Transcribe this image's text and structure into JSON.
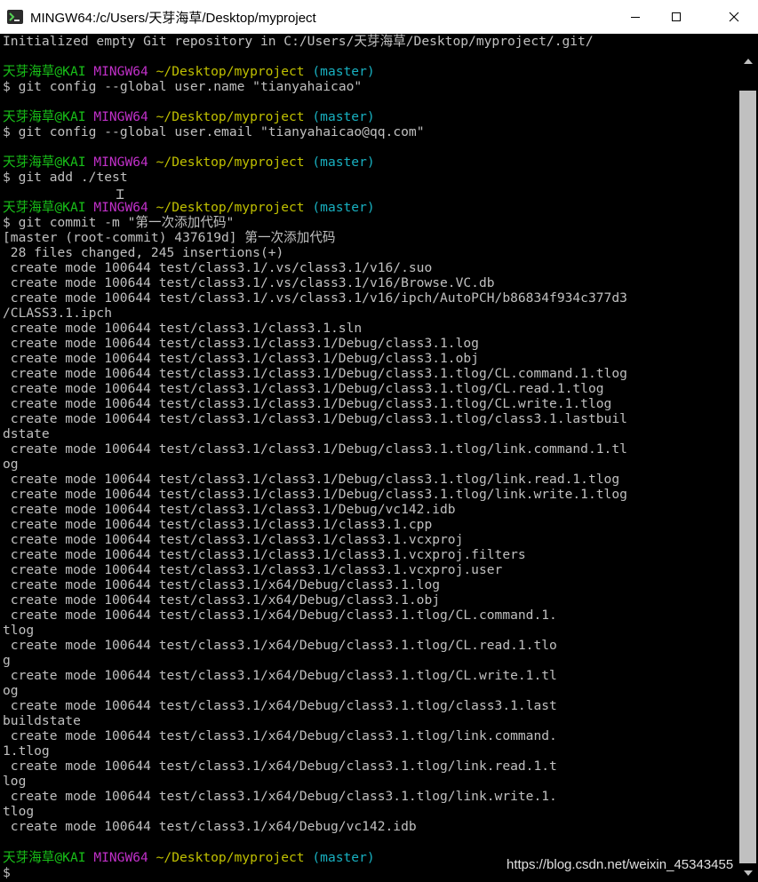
{
  "window": {
    "title": "MINGW64:/c/Users/天芽海草/Desktop/myproject",
    "icon": "mingw-terminal-icon",
    "controls": [
      "minimize-icon",
      "maximize-icon",
      "close-icon"
    ]
  },
  "colors": {
    "background": "#000000",
    "text": "#c0c0c0",
    "user_host": "#18c018",
    "system": "#c030c8",
    "path": "#c0c000",
    "branch": "#18b0c0"
  },
  "prompt": {
    "user_host": "天芽海草@KAI",
    "system": "MINGW64",
    "path": "~/Desktop/myproject",
    "branch": "(master)",
    "symbol": "$"
  },
  "commands": [
    "git config --global user.name \"tianyahaicao\"",
    "git config --global user.email \"tianyahaicao@qq.com\"",
    "git add ./test",
    "git commit -m \"第一次添加代码\""
  ],
  "output": {
    "init": "Initialized empty Git repository in C:/Users/天芽海草/Desktop/myproject/.git/",
    "commit": [
      "[master (root-commit) 437619d] 第一次添加代码",
      " 28 files changed, 245 insertions(+)",
      " create mode 100644 test/class3.1/.vs/class3.1/v16/.suo",
      " create mode 100644 test/class3.1/.vs/class3.1/v16/Browse.VC.db",
      " create mode 100644 test/class3.1/.vs/class3.1/v16/ipch/AutoPCH/b86834f934c377d3",
      "/CLASS3.1.ipch",
      " create mode 100644 test/class3.1/class3.1.sln",
      " create mode 100644 test/class3.1/class3.1/Debug/class3.1.log",
      " create mode 100644 test/class3.1/class3.1/Debug/class3.1.obj",
      " create mode 100644 test/class3.1/class3.1/Debug/class3.1.tlog/CL.command.1.tlog",
      " create mode 100644 test/class3.1/class3.1/Debug/class3.1.tlog/CL.read.1.tlog",
      " create mode 100644 test/class3.1/class3.1/Debug/class3.1.tlog/CL.write.1.tlog",
      " create mode 100644 test/class3.1/class3.1/Debug/class3.1.tlog/class3.1.lastbuil",
      "dstate",
      " create mode 100644 test/class3.1/class3.1/Debug/class3.1.tlog/link.command.1.tl",
      "og",
      " create mode 100644 test/class3.1/class3.1/Debug/class3.1.tlog/link.read.1.tlog",
      " create mode 100644 test/class3.1/class3.1/Debug/class3.1.tlog/link.write.1.tlog",
      " create mode 100644 test/class3.1/class3.1/Debug/vc142.idb",
      " create mode 100644 test/class3.1/class3.1/class3.1.cpp",
      " create mode 100644 test/class3.1/class3.1/class3.1.vcxproj",
      " create mode 100644 test/class3.1/class3.1/class3.1.vcxproj.filters",
      " create mode 100644 test/class3.1/class3.1/class3.1.vcxproj.user",
      " create mode 100644 test/class3.1/x64/Debug/class3.1.log",
      " create mode 100644 test/class3.1/x64/Debug/class3.1.obj",
      " create mode 100644 test/class3.1/x64/Debug/class3.1.tlog/CL.command.1.",
      "tlog",
      " create mode 100644 test/class3.1/x64/Debug/class3.1.tlog/CL.read.1.tlo",
      "g",
      " create mode 100644 test/class3.1/x64/Debug/class3.1.tlog/CL.write.1.tl",
      "og",
      " create mode 100644 test/class3.1/x64/Debug/class3.1.tlog/class3.1.last",
      "buildstate",
      " create mode 100644 test/class3.1/x64/Debug/class3.1.tlog/link.command.",
      "1.tlog",
      " create mode 100644 test/class3.1/x64/Debug/class3.1.tlog/link.read.1.t",
      "log",
      " create mode 100644 test/class3.1/x64/Debug/class3.1.tlog/link.write.1.",
      "tlog",
      " create mode 100644 test/class3.1/x64/Debug/vc142.idb"
    ]
  },
  "watermark": "https://blog.csdn.net/weixin_45343455"
}
